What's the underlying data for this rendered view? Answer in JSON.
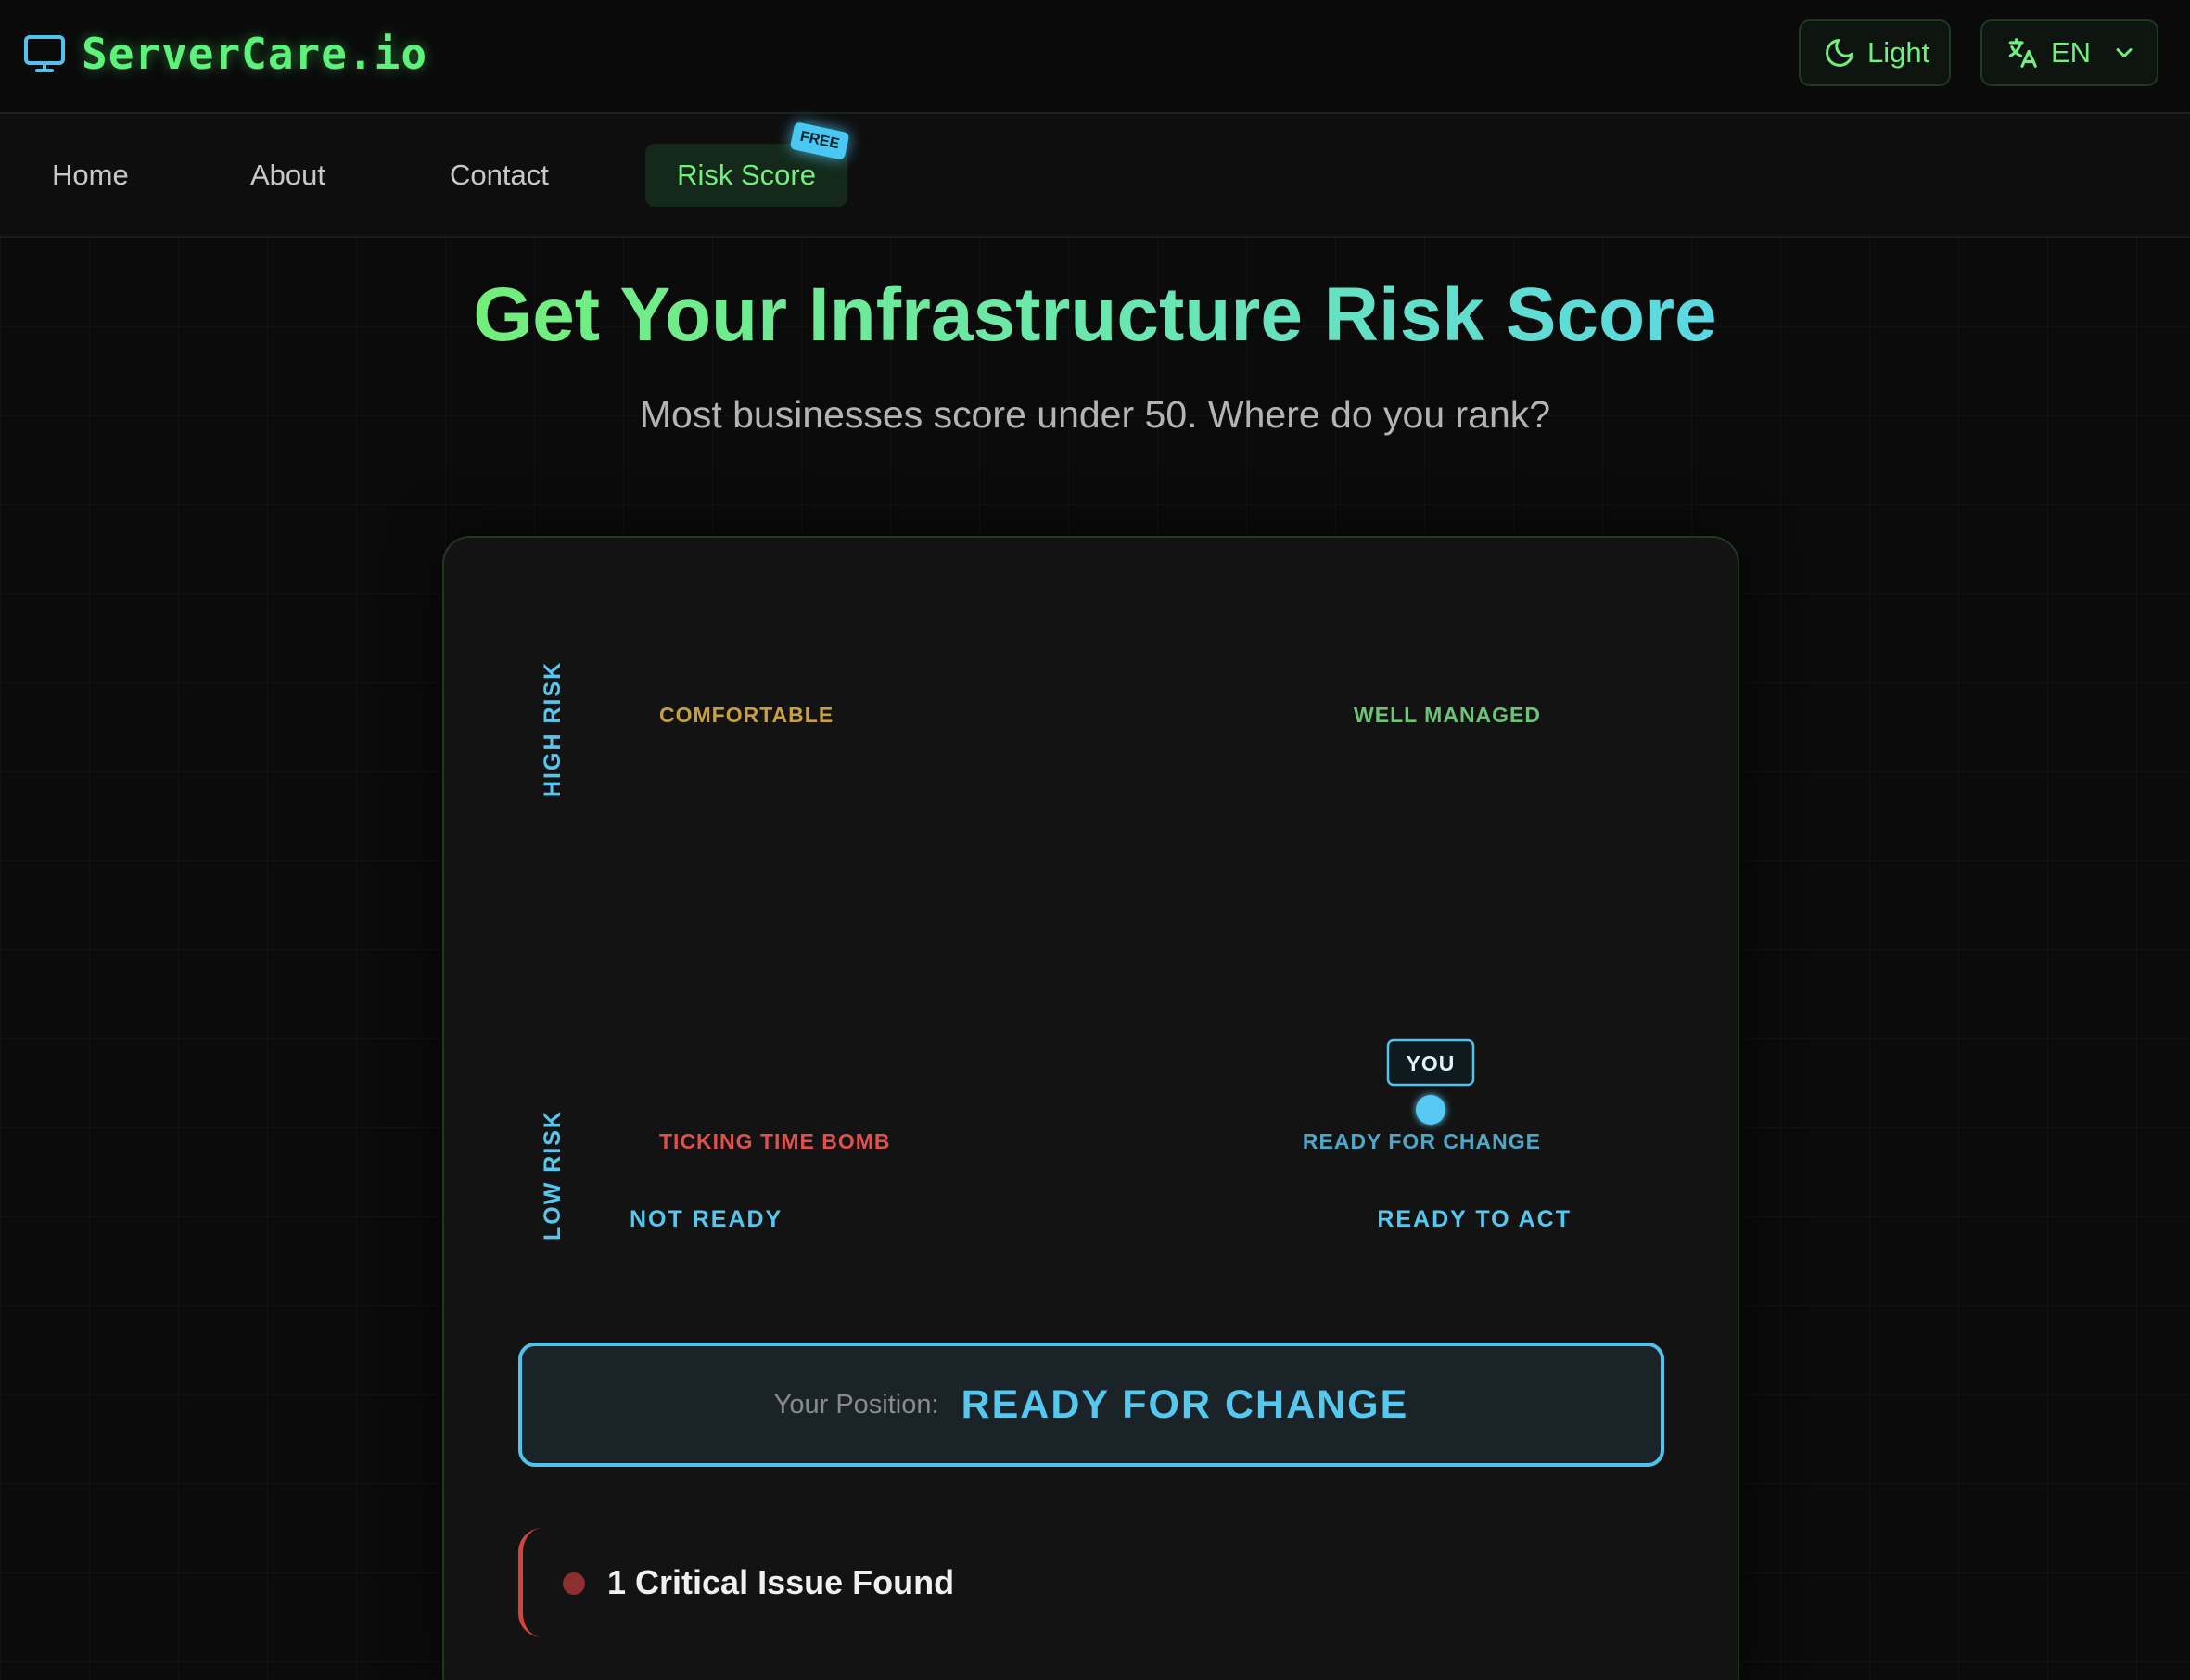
{
  "header": {
    "brand": "ServerCare.io",
    "theme_label": "Light",
    "lang_label": "EN"
  },
  "nav": {
    "items": [
      {
        "label": "Home"
      },
      {
        "label": "About"
      },
      {
        "label": "Contact"
      },
      {
        "label": "Risk Score",
        "active": true,
        "badge": "FREE"
      }
    ]
  },
  "hero": {
    "title": "Get Your Infrastructure Risk Score",
    "subtitle": "Most businesses score under 50. Where do you rank?"
  },
  "matrix": {
    "y_axis": {
      "top": "HIGH RISK",
      "bottom": "LOW RISK"
    },
    "x_axis": {
      "left": "NOT READY",
      "right": "READY TO ACT"
    },
    "quadrants": {
      "top_left": "COMFORTABLE",
      "top_right": "WELL MANAGED",
      "bottom_left": "TICKING TIME BOMB",
      "bottom_right": "READY FOR CHANGE"
    },
    "marker_label": "YOU",
    "colors": {
      "accent": "#55c8f0",
      "comfortable": "#c9a040",
      "well_managed": "#6cc477",
      "ticking": "#e0504c",
      "ready_for_change": "#4ea7c8"
    }
  },
  "result": {
    "caption": "Your Position:",
    "value": "READY FOR CHANGE"
  },
  "issues": {
    "summary": "1 Critical Issue Found"
  }
}
